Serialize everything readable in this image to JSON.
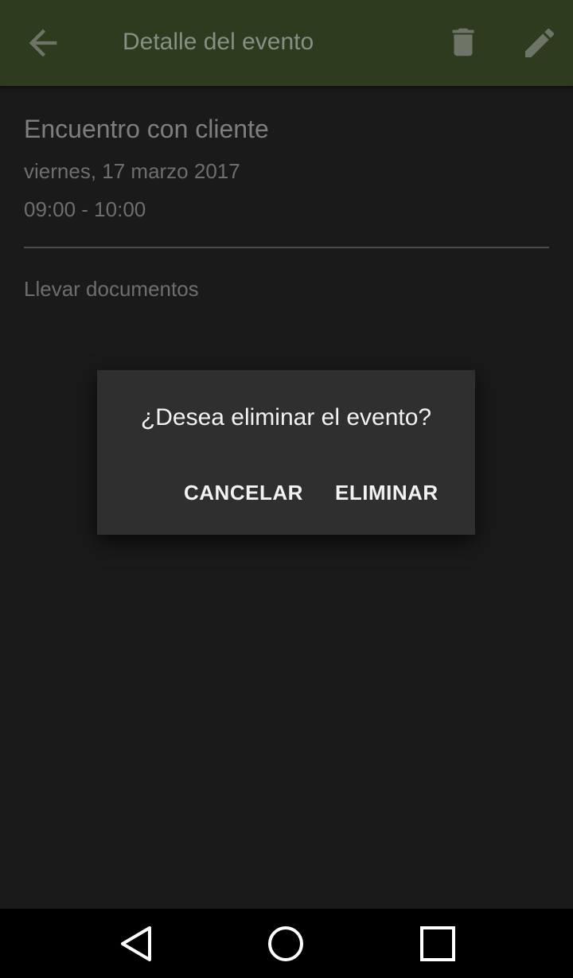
{
  "app_bar": {
    "title": "Detalle del evento",
    "background": "#2e3b1f",
    "icons": {
      "back": "arrow-back-icon",
      "delete": "trash-icon",
      "edit": "pencil-icon"
    }
  },
  "event": {
    "title": "Encuentro con cliente",
    "date": "viernes, 17 marzo 2017",
    "time": "09:00 - 10:00",
    "notes": "Llevar documentos"
  },
  "dialog": {
    "message": "¿Desea eliminar el evento?",
    "cancel_label": "CANCELAR",
    "confirm_label": "ELIMINAR"
  },
  "nav_bar": {
    "icons": {
      "back": "nav-back-icon",
      "home": "nav-home-icon",
      "recents": "nav-recents-icon"
    }
  }
}
